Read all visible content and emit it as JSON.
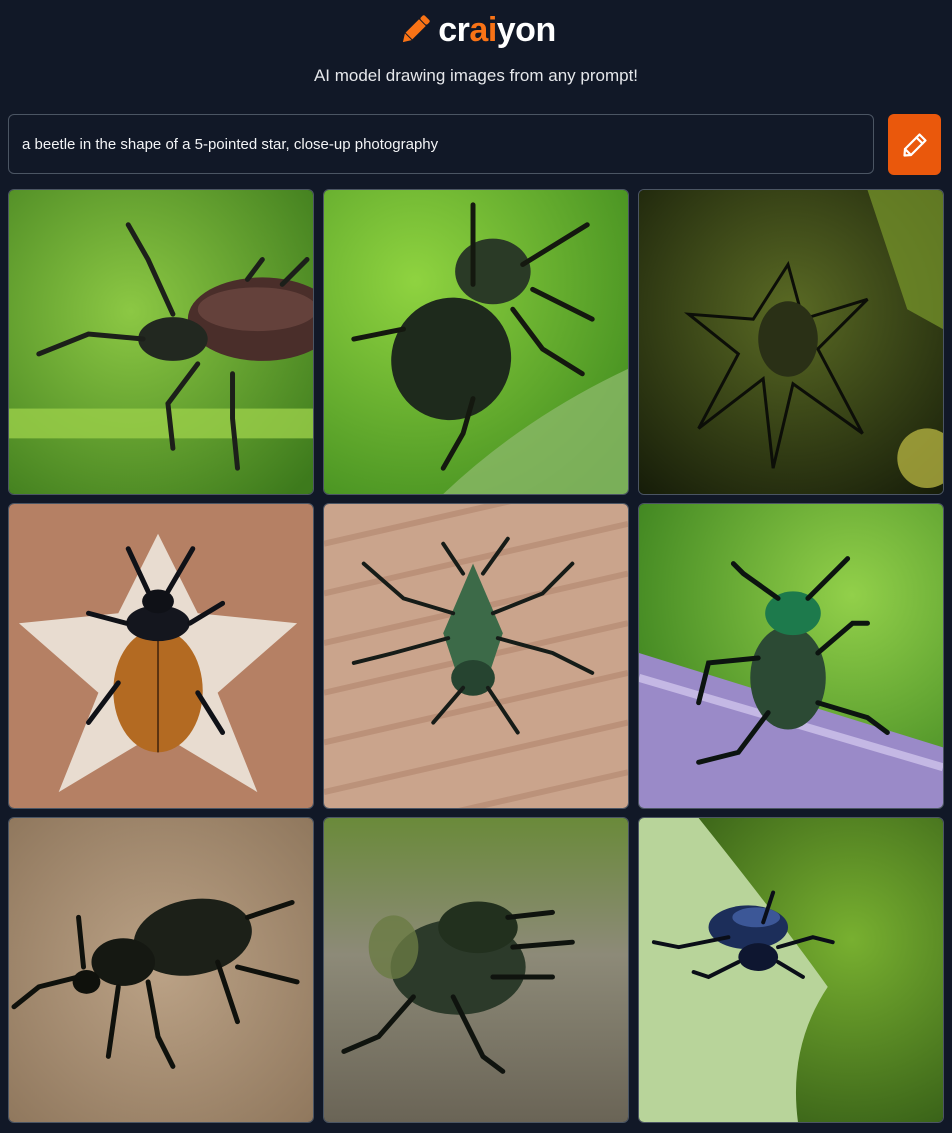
{
  "header": {
    "logo_icon": "pencil-icon",
    "brand_parts": [
      "cr",
      "ai",
      "yon"
    ],
    "tagline": "AI model drawing images from any prompt!"
  },
  "prompt": {
    "value": "a beetle in the shape of a 5-pointed star, close-up photography",
    "button_icon": "pencil-icon"
  },
  "colors": {
    "background": "#111827",
    "accent": "#f97316",
    "button": "#ea580c",
    "border": "#4b5563"
  },
  "results": {
    "images": [
      {
        "subject": "beetle-photo",
        "background": "#6aa830"
      },
      {
        "subject": "beetle-photo",
        "background": "#5fa02a"
      },
      {
        "subject": "beetle-photo",
        "background": "#3a4a1a"
      },
      {
        "subject": "beetle-photo",
        "background": "#b07c5c"
      },
      {
        "subject": "beetle-photo",
        "background": "#c6a08a"
      },
      {
        "subject": "beetle-photo",
        "background": "#6fb83a"
      },
      {
        "subject": "beetle-photo",
        "background": "#a38b72"
      },
      {
        "subject": "beetle-photo",
        "background": "#5d6a48"
      },
      {
        "subject": "beetle-photo",
        "background": "#5f8a2c"
      }
    ]
  }
}
